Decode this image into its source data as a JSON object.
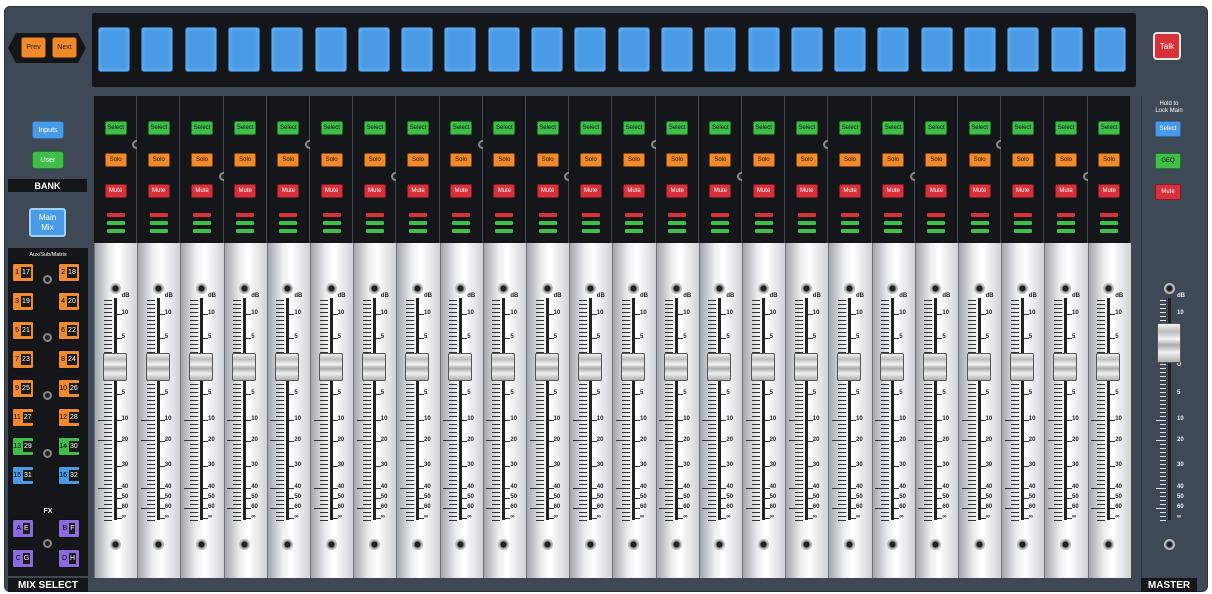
{
  "nav": {
    "prev_label": "Prev",
    "next_label": "Next"
  },
  "talk_label": "Talk",
  "bank": {
    "label": "BANK",
    "inputs_label": "Inputs",
    "user_label": "User"
  },
  "main_mix": {
    "line1": "Main",
    "line2": "Mix"
  },
  "aux_header": "Aux/Sub/Matrix",
  "fx_header": "FX",
  "mix_select_label": "MIX SELECT",
  "master_label": "MASTER",
  "mix_buttons": [
    {
      "top": "1",
      "num": "17",
      "color": "#f08a2a"
    },
    {
      "top": "2",
      "num": "18",
      "color": "#f08a2a"
    },
    {
      "top": "3",
      "num": "19",
      "color": "#f08a2a"
    },
    {
      "top": "4",
      "num": "20",
      "color": "#f08a2a"
    },
    {
      "top": "5",
      "num": "21",
      "color": "#f08a2a"
    },
    {
      "top": "6",
      "num": "22",
      "color": "#f08a2a"
    },
    {
      "top": "7",
      "num": "23",
      "color": "#f08a2a"
    },
    {
      "top": "8",
      "num": "24",
      "color": "#f08a2a"
    },
    {
      "top": "9",
      "num": "25",
      "color": "#f08a2a"
    },
    {
      "top": "10",
      "num": "26",
      "color": "#f08a2a"
    },
    {
      "top": "11",
      "num": "27",
      "color": "#f08a2a"
    },
    {
      "top": "12",
      "num": "28",
      "color": "#f08a2a"
    },
    {
      "top": "13",
      "num": "29",
      "color": "#3fbf4a"
    },
    {
      "top": "14",
      "num": "30",
      "color": "#3fbf4a"
    },
    {
      "top": "15",
      "num": "31",
      "color": "#4a9be6"
    },
    {
      "top": "16",
      "num": "32",
      "color": "#4a9be6"
    }
  ],
  "fx_buttons": [
    {
      "top": "A",
      "num": "E"
    },
    {
      "top": "B",
      "num": "F"
    },
    {
      "top": "C",
      "num": "G"
    },
    {
      "top": "D",
      "num": "H"
    }
  ],
  "channel": {
    "select": "Select",
    "solo": "Solo",
    "mute": "Mute"
  },
  "scale_marks": [
    "dB",
    "10",
    "5",
    "U",
    "5",
    "10",
    "20",
    "30",
    "40",
    "50",
    "60",
    "∞"
  ],
  "master": {
    "hold_line1": "Hold to",
    "hold_line2": "Lock Main",
    "select": "Select",
    "geq": "GEQ",
    "mute": "Mute"
  },
  "colors": {
    "select": "#3fbf4a",
    "solo": "#f08a2a",
    "mute": "#d8313a",
    "strip": "#4a9be6",
    "fx": "#8c6be0"
  }
}
